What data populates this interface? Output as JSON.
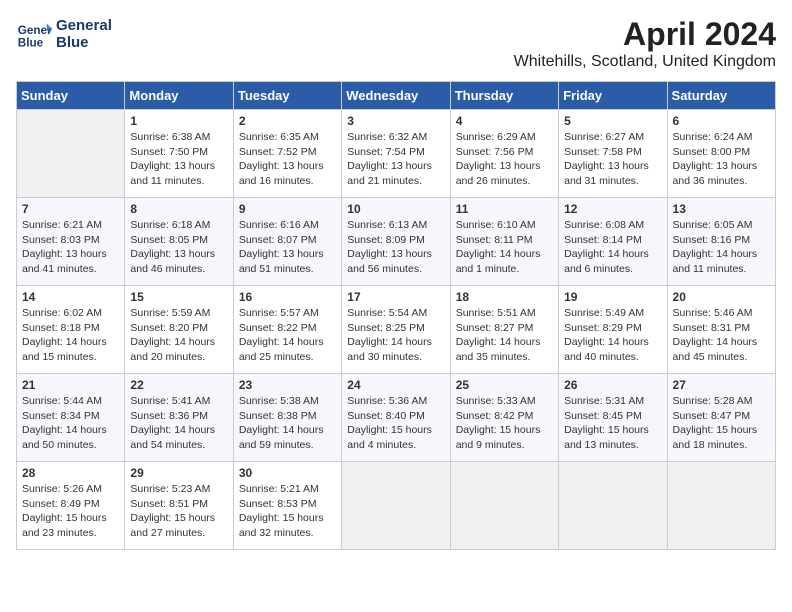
{
  "header": {
    "logo_line1": "General",
    "logo_line2": "Blue",
    "month": "April 2024",
    "location": "Whitehills, Scotland, United Kingdom"
  },
  "weekdays": [
    "Sunday",
    "Monday",
    "Tuesday",
    "Wednesday",
    "Thursday",
    "Friday",
    "Saturday"
  ],
  "weeks": [
    [
      {
        "day": "",
        "empty": true
      },
      {
        "day": "1",
        "sunrise": "6:38 AM",
        "sunset": "7:50 PM",
        "daylight": "13 hours and 11 minutes."
      },
      {
        "day": "2",
        "sunrise": "6:35 AM",
        "sunset": "7:52 PM",
        "daylight": "13 hours and 16 minutes."
      },
      {
        "day": "3",
        "sunrise": "6:32 AM",
        "sunset": "7:54 PM",
        "daylight": "13 hours and 21 minutes."
      },
      {
        "day": "4",
        "sunrise": "6:29 AM",
        "sunset": "7:56 PM",
        "daylight": "13 hours and 26 minutes."
      },
      {
        "day": "5",
        "sunrise": "6:27 AM",
        "sunset": "7:58 PM",
        "daylight": "13 hours and 31 minutes."
      },
      {
        "day": "6",
        "sunrise": "6:24 AM",
        "sunset": "8:00 PM",
        "daylight": "13 hours and 36 minutes."
      }
    ],
    [
      {
        "day": "7",
        "sunrise": "6:21 AM",
        "sunset": "8:03 PM",
        "daylight": "13 hours and 41 minutes."
      },
      {
        "day": "8",
        "sunrise": "6:18 AM",
        "sunset": "8:05 PM",
        "daylight": "13 hours and 46 minutes."
      },
      {
        "day": "9",
        "sunrise": "6:16 AM",
        "sunset": "8:07 PM",
        "daylight": "13 hours and 51 minutes."
      },
      {
        "day": "10",
        "sunrise": "6:13 AM",
        "sunset": "8:09 PM",
        "daylight": "13 hours and 56 minutes."
      },
      {
        "day": "11",
        "sunrise": "6:10 AM",
        "sunset": "8:11 PM",
        "daylight": "14 hours and 1 minute."
      },
      {
        "day": "12",
        "sunrise": "6:08 AM",
        "sunset": "8:14 PM",
        "daylight": "14 hours and 6 minutes."
      },
      {
        "day": "13",
        "sunrise": "6:05 AM",
        "sunset": "8:16 PM",
        "daylight": "14 hours and 11 minutes."
      }
    ],
    [
      {
        "day": "14",
        "sunrise": "6:02 AM",
        "sunset": "8:18 PM",
        "daylight": "14 hours and 15 minutes."
      },
      {
        "day": "15",
        "sunrise": "5:59 AM",
        "sunset": "8:20 PM",
        "daylight": "14 hours and 20 minutes."
      },
      {
        "day": "16",
        "sunrise": "5:57 AM",
        "sunset": "8:22 PM",
        "daylight": "14 hours and 25 minutes."
      },
      {
        "day": "17",
        "sunrise": "5:54 AM",
        "sunset": "8:25 PM",
        "daylight": "14 hours and 30 minutes."
      },
      {
        "day": "18",
        "sunrise": "5:51 AM",
        "sunset": "8:27 PM",
        "daylight": "14 hours and 35 minutes."
      },
      {
        "day": "19",
        "sunrise": "5:49 AM",
        "sunset": "8:29 PM",
        "daylight": "14 hours and 40 minutes."
      },
      {
        "day": "20",
        "sunrise": "5:46 AM",
        "sunset": "8:31 PM",
        "daylight": "14 hours and 45 minutes."
      }
    ],
    [
      {
        "day": "21",
        "sunrise": "5:44 AM",
        "sunset": "8:34 PM",
        "daylight": "14 hours and 50 minutes."
      },
      {
        "day": "22",
        "sunrise": "5:41 AM",
        "sunset": "8:36 PM",
        "daylight": "14 hours and 54 minutes."
      },
      {
        "day": "23",
        "sunrise": "5:38 AM",
        "sunset": "8:38 PM",
        "daylight": "14 hours and 59 minutes."
      },
      {
        "day": "24",
        "sunrise": "5:36 AM",
        "sunset": "8:40 PM",
        "daylight": "15 hours and 4 minutes."
      },
      {
        "day": "25",
        "sunrise": "5:33 AM",
        "sunset": "8:42 PM",
        "daylight": "15 hours and 9 minutes."
      },
      {
        "day": "26",
        "sunrise": "5:31 AM",
        "sunset": "8:45 PM",
        "daylight": "15 hours and 13 minutes."
      },
      {
        "day": "27",
        "sunrise": "5:28 AM",
        "sunset": "8:47 PM",
        "daylight": "15 hours and 18 minutes."
      }
    ],
    [
      {
        "day": "28",
        "sunrise": "5:26 AM",
        "sunset": "8:49 PM",
        "daylight": "15 hours and 23 minutes."
      },
      {
        "day": "29",
        "sunrise": "5:23 AM",
        "sunset": "8:51 PM",
        "daylight": "15 hours and 27 minutes."
      },
      {
        "day": "30",
        "sunrise": "5:21 AM",
        "sunset": "8:53 PM",
        "daylight": "15 hours and 32 minutes."
      },
      {
        "day": "",
        "empty": true
      },
      {
        "day": "",
        "empty": true
      },
      {
        "day": "",
        "empty": true
      },
      {
        "day": "",
        "empty": true
      }
    ]
  ]
}
